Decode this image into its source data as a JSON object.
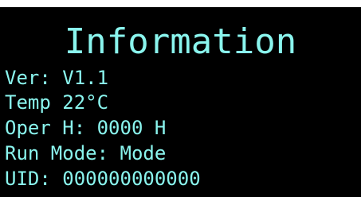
{
  "display": {
    "title": "Information",
    "lines": [
      "Ver: V1.1",
      "Temp 22°C",
      "Oper H: 0000 H",
      "Run Mode: Mode",
      "UID: 000000000000"
    ],
    "colors": {
      "background": "#000000",
      "text": "#8af5ee",
      "frame": "#ffffff"
    }
  }
}
